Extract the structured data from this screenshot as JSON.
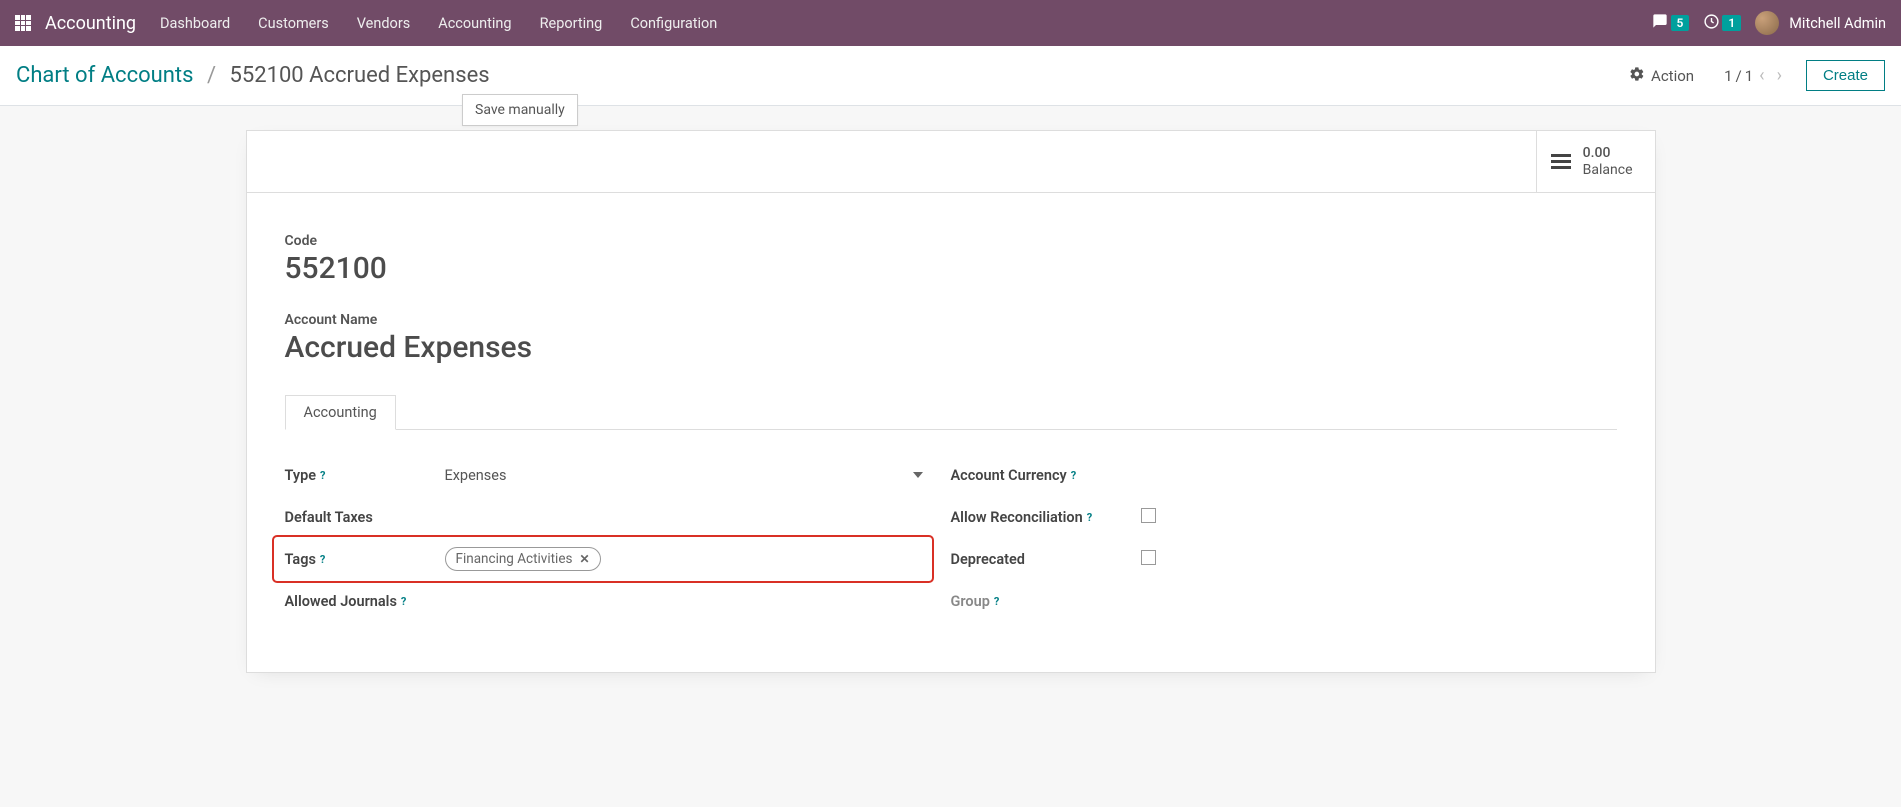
{
  "navbar": {
    "brand": "Accounting",
    "items": [
      "Dashboard",
      "Customers",
      "Vendors",
      "Accounting",
      "Reporting",
      "Configuration"
    ],
    "messages_badge": "5",
    "activities_badge": "1",
    "user": "Mitchell Admin"
  },
  "controlbar": {
    "crumb_root": "Chart of Accounts",
    "crumb_current": "552100 Accrued Expenses",
    "action_label": "Action",
    "pager_current": "1",
    "pager_total": "1",
    "create_label": "Create"
  },
  "tooltip": {
    "text": "Save manually"
  },
  "stat": {
    "value": "0.00",
    "label": "Balance"
  },
  "form": {
    "code_label": "Code",
    "code_value": "552100",
    "name_label": "Account Name",
    "name_value": "Accrued Expenses",
    "tab_label": "Accounting",
    "left": {
      "type_label": "Type",
      "type_value": "Expenses",
      "default_taxes_label": "Default Taxes",
      "tags_label": "Tags",
      "tags_value": "Financing Activities",
      "allowed_journals_label": "Allowed Journals"
    },
    "right": {
      "currency_label": "Account Currency",
      "allow_reconcile_label": "Allow Reconciliation",
      "deprecated_label": "Deprecated",
      "group_label": "Group"
    }
  }
}
